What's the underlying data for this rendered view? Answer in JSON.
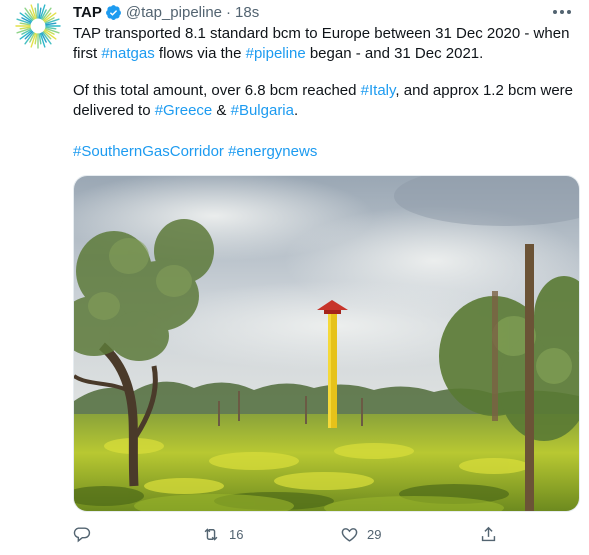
{
  "tweet": {
    "display_name": "TAP",
    "handle": "@tap_pipeline",
    "separator": "·",
    "time": "18s",
    "lines": [
      [
        {
          "t": "TAP transported 8.1 standard bcm to Europe between 31 Dec 2020 - when",
          "link": false
        }
      ],
      [
        {
          "t": "first ",
          "link": false
        },
        {
          "t": "#natgas",
          "link": true
        },
        {
          "t": " flows via the ",
          "link": false
        },
        {
          "t": "#pipeline",
          "link": true
        },
        {
          "t": " began - and 31 Dec 2021.",
          "link": false
        }
      ],
      [
        {
          "t": "Of this total amount, over 6.8 bcm reached ",
          "link": false
        },
        {
          "t": "#Italy",
          "link": true
        },
        {
          "t": ", and approx 1.2 bcm were",
          "link": false
        }
      ],
      [
        {
          "t": "delivered to ",
          "link": false
        },
        {
          "t": "#Greece",
          "link": true
        },
        {
          "t": " & ",
          "link": false
        },
        {
          "t": "#Bulgaria",
          "link": true
        },
        {
          "t": ".",
          "link": false
        }
      ],
      [
        {
          "t": "#SouthernGasCorridor",
          "link": true
        },
        {
          "t": " ",
          "link": false
        },
        {
          "t": "#energynews",
          "link": true
        }
      ]
    ]
  },
  "actions": {
    "reply_icon": "reply-icon",
    "retweet_icon": "retweet-icon",
    "retweet_count": "16",
    "like_icon": "heart-icon",
    "like_count": "29",
    "share_icon": "share-icon"
  },
  "colors": {
    "link": "#1d9bf0",
    "muted": "#536471",
    "text": "#0f1419",
    "verified": "#1d9bf0"
  }
}
